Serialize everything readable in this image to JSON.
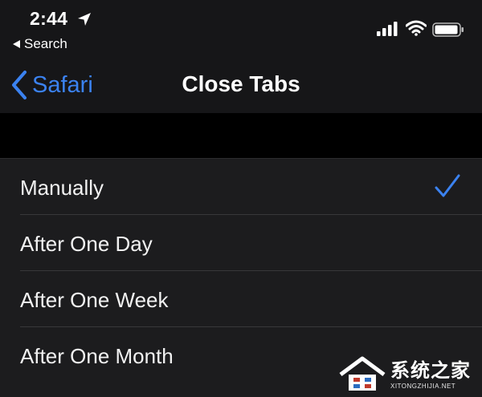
{
  "status_bar": {
    "time": "2:44",
    "back_app": "Search",
    "icons": [
      "location-arrow-icon",
      "cellular-signal-icon",
      "wifi-icon",
      "battery-icon"
    ]
  },
  "nav": {
    "back_label": "Safari",
    "title": "Close Tabs"
  },
  "options": [
    {
      "label": "Manually",
      "selected": true
    },
    {
      "label": "After One Day",
      "selected": false
    },
    {
      "label": "After One Week",
      "selected": false
    },
    {
      "label": "After One Month",
      "selected": false
    }
  ],
  "watermark": {
    "text_cn": "系统之家",
    "text_en": "XITONGZHIJIA.NET"
  },
  "colors": {
    "accent": "#3b82f0",
    "header_bg": "#161618",
    "cell_bg": "#1c1c1e",
    "separator": "#38383a"
  }
}
